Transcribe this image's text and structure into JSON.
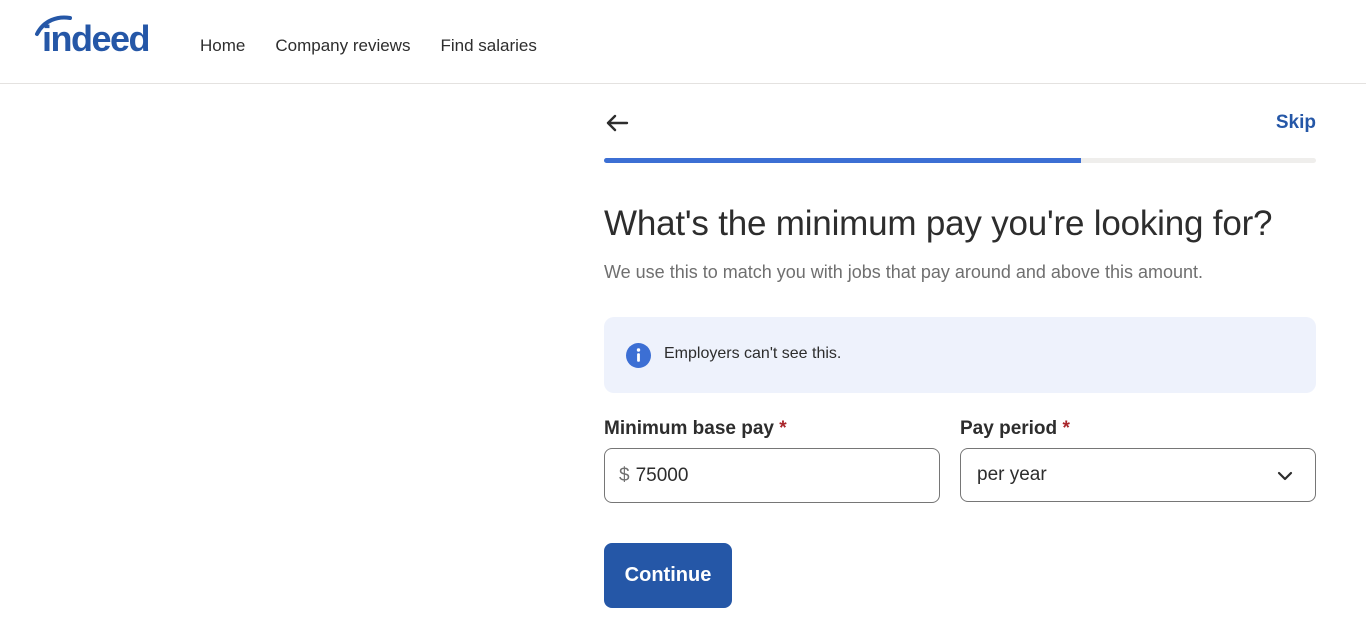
{
  "header": {
    "logo_text": "indeed",
    "nav": [
      {
        "label": "Home"
      },
      {
        "label": "Company reviews"
      },
      {
        "label": "Find salaries"
      }
    ]
  },
  "wizard": {
    "skip_label": "Skip",
    "progress_fraction": 0.67,
    "title": "What's the minimum pay you're looking for?",
    "subtitle": "We use this to match you with jobs that pay around and above this amount.",
    "info_text": "Employers can't see this.",
    "min_pay": {
      "label": "Minimum base pay",
      "required_mark": "*",
      "currency_symbol": "$",
      "value": "75000"
    },
    "pay_period": {
      "label": "Pay period",
      "required_mark": "*",
      "selected": "per year"
    },
    "continue_label": "Continue"
  },
  "colors": {
    "brand_blue": "#2557a7",
    "progress_blue": "#3c6fd4",
    "info_bg": "#eef2fc",
    "required_red": "#a9252b"
  },
  "icons": {
    "back": "arrow-left-icon",
    "info": "info-icon",
    "chevron": "chevron-down-icon"
  }
}
